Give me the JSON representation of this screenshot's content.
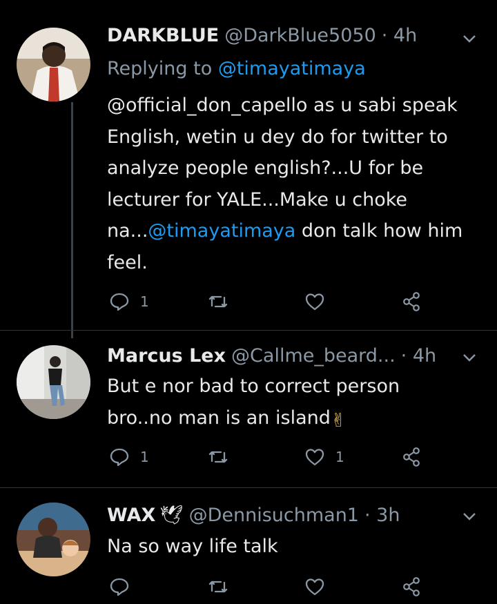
{
  "tweets": [
    {
      "name": "DARKBLUE",
      "handle": "@DarkBlue5050",
      "time": "· 4h",
      "reply_prefix": "Replying to ",
      "reply_mention": "@timayatimaya",
      "lines": [
        "@official_don_capello as u sabi speak",
        "English, wetin u dey do for twitter to",
        "analyze people english?...U for be",
        "lecturer for YALE...Make u choke",
        "na...",
        " don talk how him",
        "feel."
      ],
      "line5_mention": "@timayatimaya",
      "reply_count": "1",
      "retweet_count": "",
      "like_count": ""
    },
    {
      "name": "Marcus Lex",
      "handle": "@Callme_beard...",
      "time": "· 4h",
      "lines": [
        "But e nor bad to correct person",
        "bro..no man is an island"
      ],
      "emoji": "✌",
      "reply_count": "1",
      "retweet_count": "",
      "like_count": "1"
    },
    {
      "name": "WAX",
      "name_emoji": "🕊",
      "handle": "@Dennisuchman1",
      "time": "· 3h",
      "lines": [
        "Na so way life talk"
      ],
      "reply_count": "",
      "retweet_count": "",
      "like_count": ""
    }
  ],
  "colors": {
    "background": "#000000",
    "text": "#e7e9ea",
    "secondary": "#8b98a5",
    "accent": "#1d9bf0"
  }
}
